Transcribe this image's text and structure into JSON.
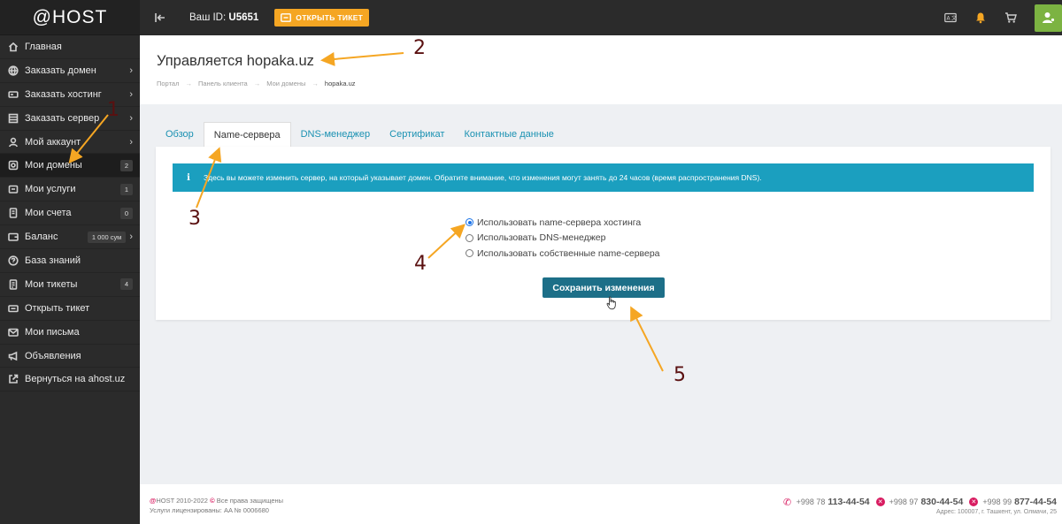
{
  "app": {
    "logo": "@HOST"
  },
  "sidebar": {
    "items": [
      {
        "label": "Главная",
        "icon": "home-icon",
        "chevron": "",
        "badge": ""
      },
      {
        "label": "Заказать домен",
        "icon": "globe-icon",
        "chevron": "›",
        "badge": ""
      },
      {
        "label": "Заказать хостинг",
        "icon": "server-icon",
        "chevron": "›",
        "badge": ""
      },
      {
        "label": "Заказать сервер",
        "icon": "list-icon",
        "chevron": "›",
        "badge": ""
      },
      {
        "label": "Мой аккаунт",
        "icon": "user-icon",
        "chevron": "›",
        "badge": ""
      },
      {
        "label": "Мои домены",
        "icon": "domain-icon",
        "chevron": "",
        "badge": "2"
      },
      {
        "label": "Мои услуги",
        "icon": "box-icon",
        "chevron": "",
        "badge": "1"
      },
      {
        "label": "Мои счета",
        "icon": "invoice-icon",
        "chevron": "",
        "badge": "0"
      },
      {
        "label": "Баланс",
        "icon": "wallet-icon",
        "chevron": "›",
        "badge": "1 000 сум"
      },
      {
        "label": "База знаний",
        "icon": "help-icon",
        "chevron": "",
        "badge": ""
      },
      {
        "label": "Мои тикеты",
        "icon": "ticket-icon",
        "chevron": "",
        "badge": "4"
      },
      {
        "label": "Открыть тикет",
        "icon": "open-ticket-icon",
        "chevron": "",
        "badge": ""
      },
      {
        "label": "Мои письма",
        "icon": "mail-icon",
        "chevron": "",
        "badge": ""
      },
      {
        "label": "Объявления",
        "icon": "megaphone-icon",
        "chevron": "",
        "badge": ""
      },
      {
        "label": "Вернуться на ahost.uz",
        "icon": "external-link-icon",
        "chevron": "",
        "badge": ""
      }
    ]
  },
  "topbar": {
    "userid_label": "Ваш ID:",
    "userid_value": "U5651",
    "ticket_button": "ОТКРЫТЬ ТИКЕТ"
  },
  "header": {
    "title": "Управляется hopaka.uz",
    "breadcrumb": [
      "Портал",
      "Панель клиента",
      "Мои домены",
      "hopaka.uz"
    ],
    "breadcrumb_sep": "→"
  },
  "tabs": [
    {
      "label": "Обзор",
      "active": false
    },
    {
      "label": "Name-сервера",
      "active": true
    },
    {
      "label": "DNS-менеджер",
      "active": false
    },
    {
      "label": "Сертификат",
      "active": false
    },
    {
      "label": "Контактные данные",
      "active": false
    }
  ],
  "panel": {
    "alert_icon": "i",
    "alert_text": "Здесь вы можете изменить сервер, на который указывает домен. Обратите внимание, что изменения могут занять до 24 часов (время распространения DNS).",
    "options": [
      {
        "label": "Использовать name-сервера хостинга",
        "selected": true
      },
      {
        "label": "Использовать DNS-менеджер",
        "selected": false
      },
      {
        "label": "Использовать собственные name-сервера",
        "selected": false
      }
    ],
    "save_button": "Сохранить изменения"
  },
  "footer": {
    "brand": "@",
    "copyright": "HOST 2010-2022",
    "rights": "Все права защищены",
    "license": "Услуги лицензированы: AA № 0006680",
    "phones": [
      {
        "prefix": "+998 78",
        "number": "113-44-54"
      },
      {
        "prefix": "+998 97",
        "number": "830-44-54"
      },
      {
        "prefix": "+998 99",
        "number": "877-44-54"
      }
    ],
    "address": "Адрес: 100007, г. Ташкент, ул. Олмачи, 25"
  },
  "annotations": [
    "1",
    "2",
    "3",
    "4",
    "5"
  ],
  "colors": {
    "accent": "#f5a623",
    "alert": "#1b9fbf",
    "button": "#1d6f88",
    "brand": "#d81b60",
    "user": "#7cb342"
  }
}
